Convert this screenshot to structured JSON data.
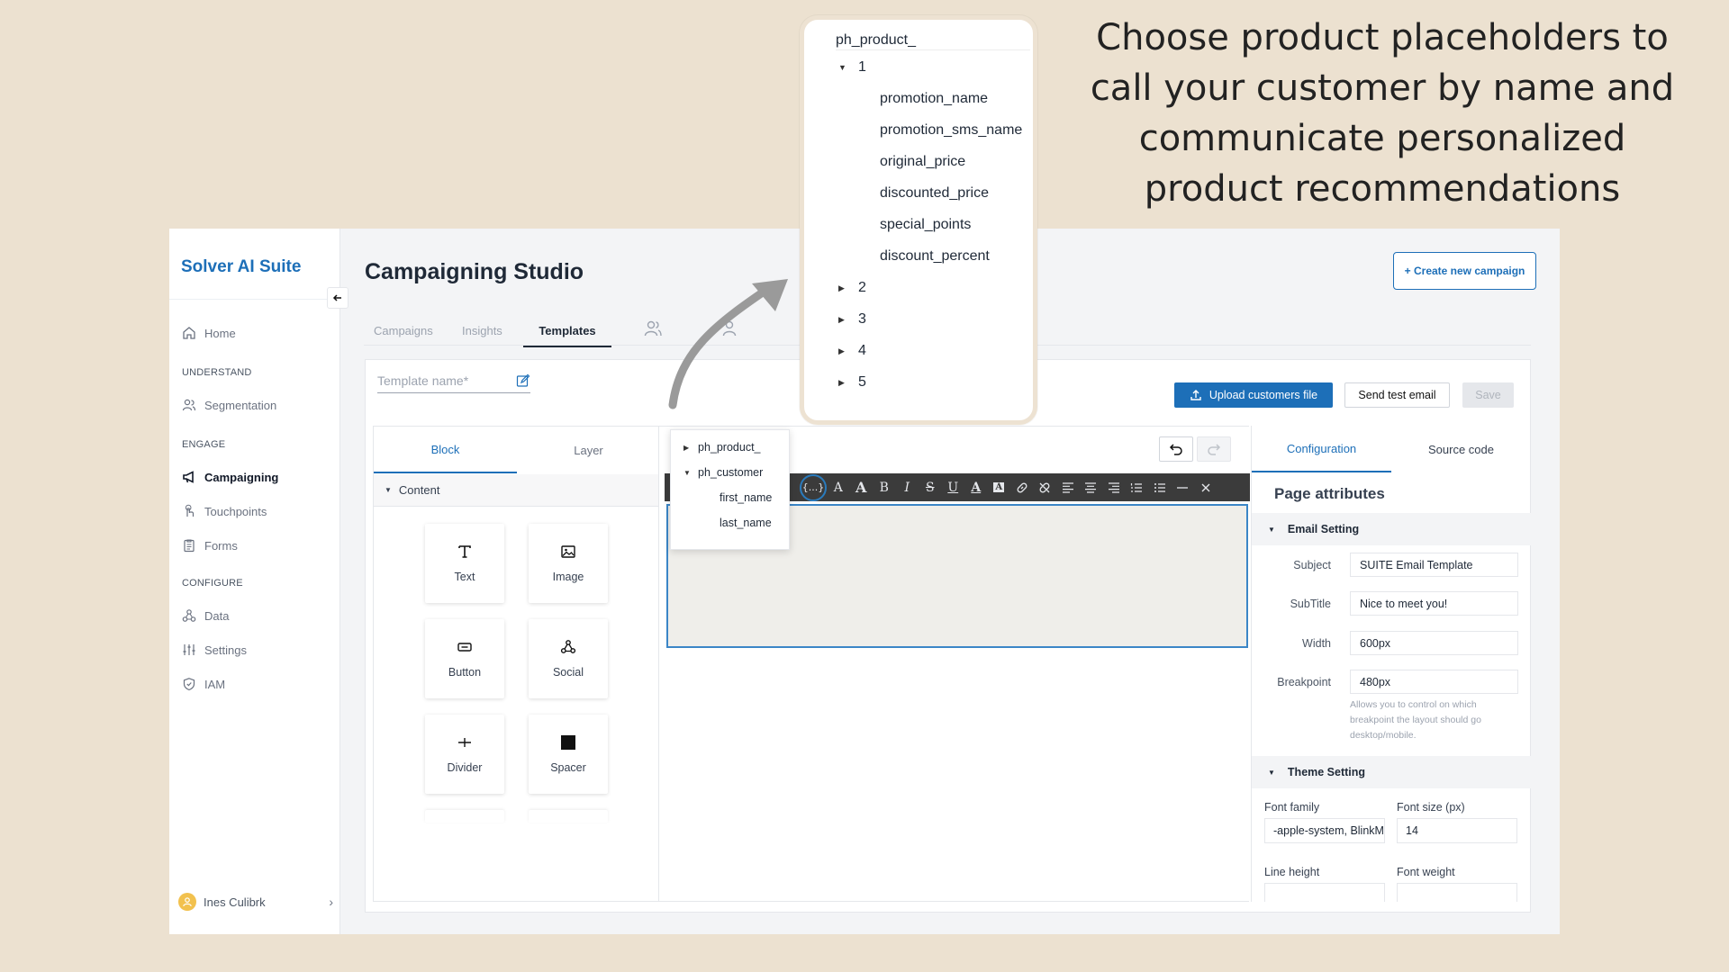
{
  "headline": "Choose product placeholders to call your customer by name and communicate personalized product recommendations",
  "brand": "Solver AI Suite",
  "page_title": "Campaigning Studio",
  "create_button": "+ Create new campaign",
  "nav": {
    "home": "Home",
    "sec_understand": "UNDERSTAND",
    "segmentation": "Segmentation",
    "sec_engage": "ENGAGE",
    "campaigning": "Campaigning",
    "touchpoints": "Touchpoints",
    "forms": "Forms",
    "sec_configure": "CONFIGURE",
    "data": "Data",
    "settings": "Settings",
    "iam": "IAM"
  },
  "user": {
    "name": "Ines Culibrk"
  },
  "tabs": {
    "campaigns": "Campaigns",
    "insights": "Insights",
    "templates": "Templates"
  },
  "template_name_placeholder": "Template name*",
  "actions": {
    "upload": "Upload customers file",
    "send_test": "Send test email",
    "save": "Save"
  },
  "left_panel": {
    "tab_block": "Block",
    "tab_layer": "Layer",
    "content_label": "Content",
    "tiles": [
      "Text",
      "Image",
      "Button",
      "Social",
      "Divider",
      "Spacer"
    ]
  },
  "placeholder_menu": {
    "items": [
      "ph_product_",
      "ph_customer",
      "first_name",
      "last_name"
    ]
  },
  "toolbar_selected_label": "{...}",
  "right_panel": {
    "tab_config": "Configuration",
    "tab_source": "Source code",
    "page_attributes": "Page attributes",
    "email_setting": "Email Setting",
    "fields": [
      {
        "label": "Subject",
        "value": "SUITE Email Template"
      },
      {
        "label": "SubTitle",
        "value": "Nice to meet you!"
      },
      {
        "label": "Width",
        "value": "600px"
      },
      {
        "label": "Breakpoint",
        "value": "480px"
      }
    ],
    "breakpoint_help": "Allows you to control on which breakpoint the layout should go desktop/mobile.",
    "theme_setting": "Theme Setting",
    "font_family_label": "Font family",
    "font_family_value": "-apple-system, BlinkMacSystemFont",
    "font_size_label": "Font size (px)",
    "font_size_value": "14",
    "line_height_label": "Line height",
    "font_weight_label": "Font weight"
  },
  "callout": {
    "title": "ph_product_",
    "group": "1",
    "items": [
      "promotion_name",
      "promotion_sms_name",
      "original_price",
      "discounted_price",
      "special_points",
      "discount_percent"
    ],
    "collapsed": [
      "2",
      "3",
      "4",
      "5"
    ]
  },
  "colors": {
    "brand": "#1d6fb8",
    "background": "#ece1d0"
  }
}
